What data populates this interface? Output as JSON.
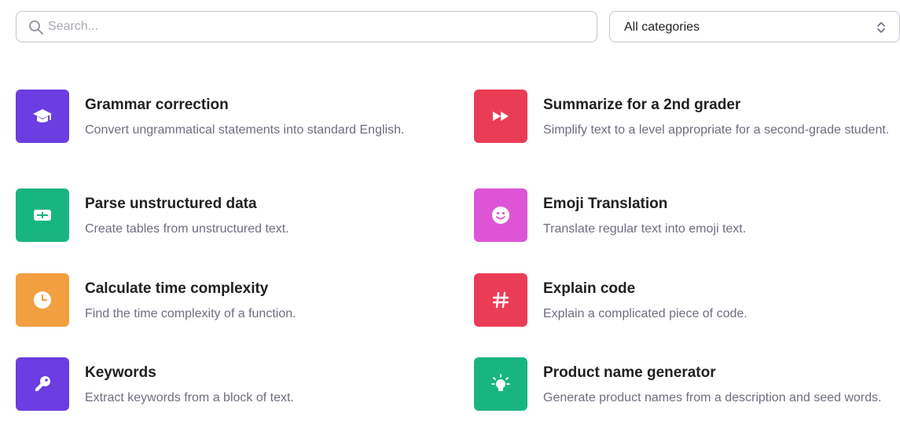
{
  "search": {
    "placeholder": "Search..."
  },
  "category_filter": {
    "selected": "All categories"
  },
  "examples": [
    {
      "title": "Grammar correction",
      "description": "Convert ungrammatical statements into standard English.",
      "icon": "graduation-cap-icon",
      "color": "#6c3de0"
    },
    {
      "title": "Summarize for a 2nd grader",
      "description": "Simplify text to a level appropriate for a second-grade student.",
      "icon": "fast-forward-icon",
      "color": "#ea3d55"
    },
    {
      "title": "Parse unstructured data",
      "description": "Create tables from unstructured text.",
      "icon": "table-icon",
      "color": "#19b580"
    },
    {
      "title": "Emoji Translation",
      "description": "Translate regular text into emoji text.",
      "icon": "smiley-icon",
      "color": "#dd55d6"
    },
    {
      "title": "Calculate time complexity",
      "description": "Find the time complexity of a function.",
      "icon": "clock-icon",
      "color": "#f2a03f"
    },
    {
      "title": "Explain code",
      "description": "Explain a complicated piece of code.",
      "icon": "hash-icon",
      "color": "#ea3d55"
    },
    {
      "title": "Keywords",
      "description": "Extract keywords from a block of text.",
      "icon": "key-icon",
      "color": "#6c3de0"
    },
    {
      "title": "Product name generator",
      "description": "Generate product names from a description and seed words.",
      "icon": "lightbulb-icon",
      "color": "#19b580"
    }
  ]
}
